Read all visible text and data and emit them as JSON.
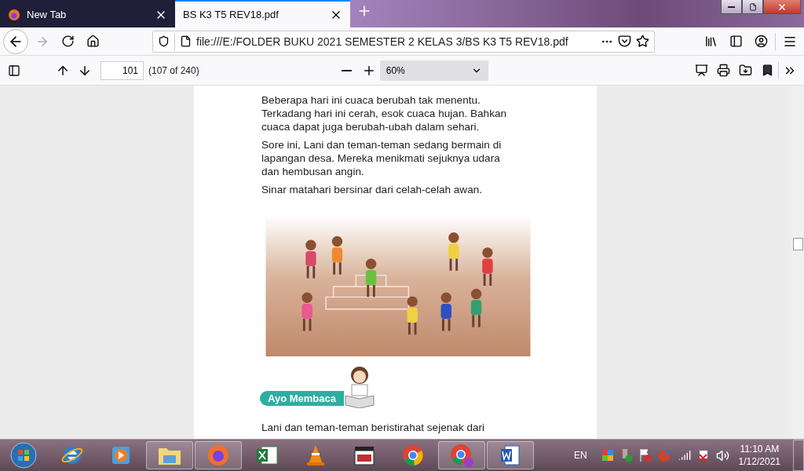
{
  "tabs": [
    {
      "title": "New Tab",
      "selected": false
    },
    {
      "title": "BS K3 T5 REV18.pdf",
      "selected": true
    }
  ],
  "address_bar": {
    "url": "file:///E:/FOLDER BUKU 2021 SEMESTER 2 KELAS 3/BS K3 T5 REV18.pdf"
  },
  "pdf_toolbar": {
    "page_number": "101",
    "page_count": "(107 of 240)",
    "zoom": "60%"
  },
  "document": {
    "paragraphs": [
      "Beberapa hari ini cuaca berubah tak menentu. Terkadang hari ini cerah, esok cuaca hujan. Bahkan cuaca dapat juga berubah-ubah dalam sehari.",
      "Sore ini, Lani dan teman-teman sedang bermain di lapangan desa. Mereka menikmati sejuknya udara dan hembusan angin.",
      "Sinar matahari bersinar dari celah-celah awan."
    ],
    "section_badge": "Ayo Membaca",
    "paragraph_after": "Lani dan teman-teman beristirahat sejenak dari"
  },
  "taskbar": {
    "apps": [
      {
        "kind": "ie",
        "running": false
      },
      {
        "kind": "media",
        "running": false
      },
      {
        "kind": "explorer",
        "running": true
      },
      {
        "kind": "firefox",
        "running": true
      },
      {
        "kind": "excel",
        "running": false
      },
      {
        "kind": "vlc",
        "running": false
      },
      {
        "kind": "mpc",
        "running": false
      },
      {
        "kind": "chrome",
        "running": false
      },
      {
        "kind": "chrome-profile",
        "running": true
      },
      {
        "kind": "word",
        "running": true
      }
    ],
    "language": "EN",
    "time": "11:10 AM",
    "date": "1/12/2021"
  }
}
